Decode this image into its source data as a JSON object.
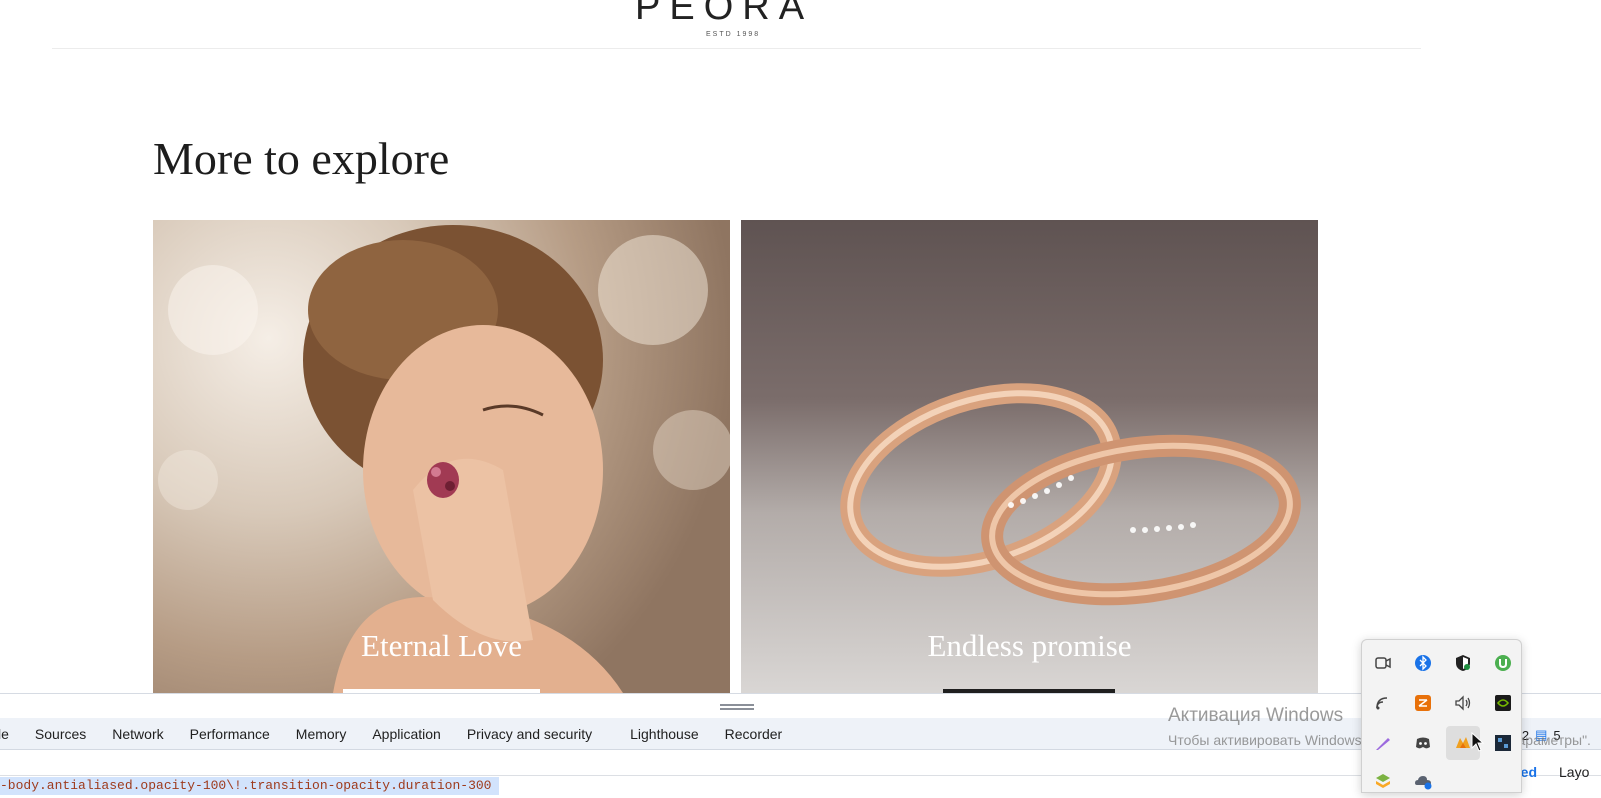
{
  "header": {
    "logo": "PEORA",
    "logo_sub": "ESTD 1998"
  },
  "main": {
    "title": "More to explore",
    "cards": [
      {
        "label": "Eternal Love"
      },
      {
        "label": "Endless promise"
      }
    ]
  },
  "devtools": {
    "tabs": [
      "le",
      "Sources",
      "Network",
      "Performance",
      "Memory",
      "Application",
      "Privacy and security",
      "Lighthouse",
      "Recorder"
    ],
    "selector": "-body.antialiased.opacity-100\\!.transition-opacity.duration-300",
    "issues": {
      "warnings": "2",
      "info": "5"
    },
    "side_tabs": {
      "computed": "ted",
      "layout": "Layo"
    }
  },
  "watermark": {
    "title": "Активация Windows",
    "subtitle": "Чтобы активировать Windows, перейдите в раздел \"Параметры\"."
  },
  "tray": {
    "icons": [
      "camera-icon",
      "bluetooth-icon",
      "security-shield-icon",
      "utorrent-icon",
      "wifi-icon",
      "app-orange-icon",
      "volume-icon",
      "nvidia-icon",
      "pen-icon",
      "discord-icon",
      "app-fox-icon",
      "app-dark-icon",
      "bluestacks-icon",
      "onedrive-icon"
    ]
  },
  "colors": {
    "accent": "#1a73e8",
    "selector_bg": "#d2e3fc",
    "selector_text": "#9e3a1c",
    "tabbar_bg": "#eef2f8"
  }
}
